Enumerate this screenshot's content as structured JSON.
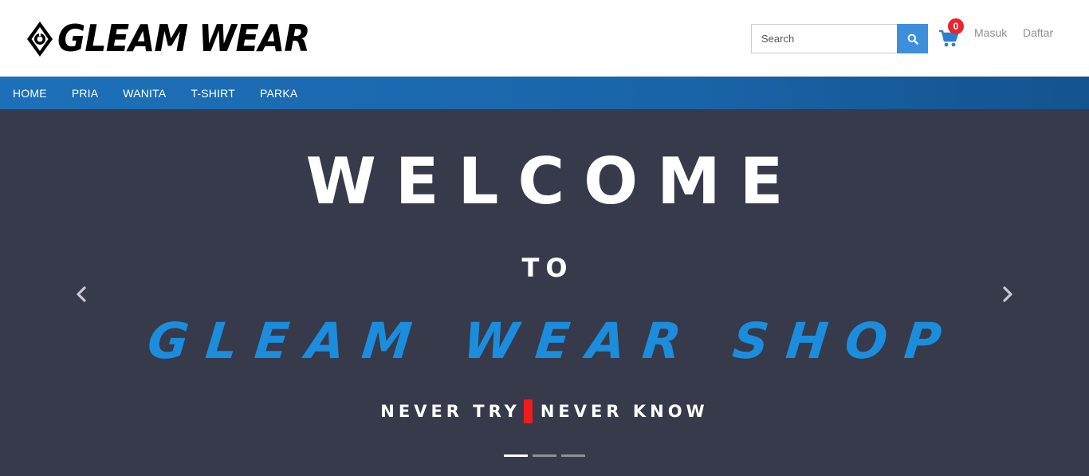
{
  "header": {
    "logo_text": "GLEAM WEAR",
    "search": {
      "placeholder": "Search"
    },
    "cart": {
      "count": "0"
    },
    "login_label": "Masuk",
    "register_label": "Daftar"
  },
  "nav": {
    "items": [
      {
        "label": "HOME"
      },
      {
        "label": "PRIA"
      },
      {
        "label": "WANITA"
      },
      {
        "label": "T-SHIRT"
      },
      {
        "label": "PARKA"
      }
    ]
  },
  "hero": {
    "line1": "WELCOME",
    "line2": "TO",
    "line3": "GLEAM WEAR SHOP",
    "tagline_left": "NEVER TRY",
    "tagline_right": "NEVER KNOW",
    "slide_count": 3,
    "active_slide": 1
  },
  "colors": {
    "nav_bg": "#1d70b8",
    "hero_bg": "#363a4a",
    "accent_blue": "#1c8ddc",
    "search_button": "#3d8fdc",
    "cart_icon": "#2d7fd0",
    "badge": "#e8262c",
    "tagline_bar": "#ee1c1c"
  },
  "icons": {
    "logo": "gleam-wear-logo-icon",
    "search": "search-icon",
    "cart": "shopping-cart-icon",
    "prev": "chevron-left-icon",
    "next": "chevron-right-icon"
  }
}
